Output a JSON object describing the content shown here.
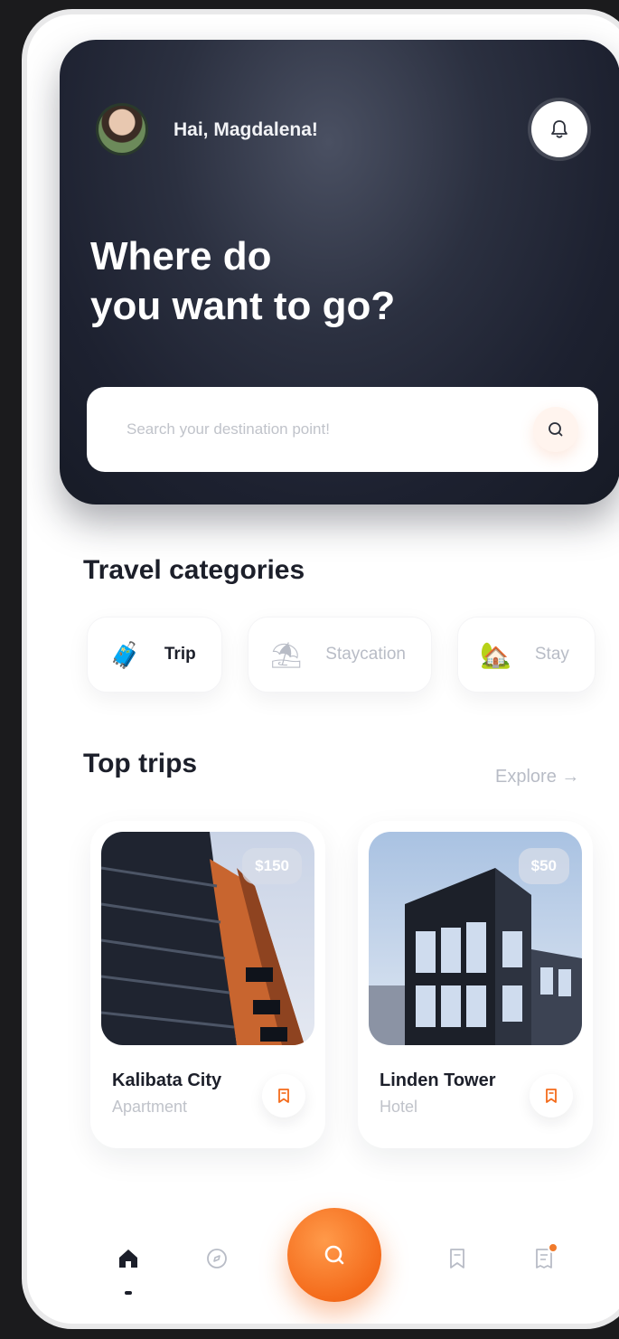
{
  "header": {
    "greeting": "Hai, Magdalena!",
    "title_line1": "Where do",
    "title_line2": "you want to go?"
  },
  "search": {
    "placeholder": "Search your destination point!"
  },
  "categories": {
    "title": "Travel categories",
    "items": [
      {
        "label": "Trip",
        "icon": "luggage-icon",
        "emoji": "🧳",
        "active": true
      },
      {
        "label": "Staycation",
        "icon": "beach-umbrella-icon",
        "emoji": "⛱",
        "active": false
      },
      {
        "label": "Stay",
        "icon": "house-icon",
        "emoji": "🏡",
        "active": false
      }
    ]
  },
  "top_trips": {
    "title": "Top trips",
    "explore_label": "Explore →",
    "items": [
      {
        "name": "Kalibata City",
        "type": "Apartment",
        "price": "$150"
      },
      {
        "name": "Linden Tower",
        "type": "Hotel",
        "price": "$50"
      }
    ]
  },
  "nav": {
    "items": [
      "home-icon",
      "compass-icon",
      "search-icon",
      "bookmark-icon",
      "receipt-icon"
    ],
    "active": "home-icon"
  },
  "colors": {
    "accent": "#f46b1b",
    "hero_bg": "#1d2130",
    "text_dark": "#1c1f2a",
    "text_muted": "#b8bcc6"
  }
}
